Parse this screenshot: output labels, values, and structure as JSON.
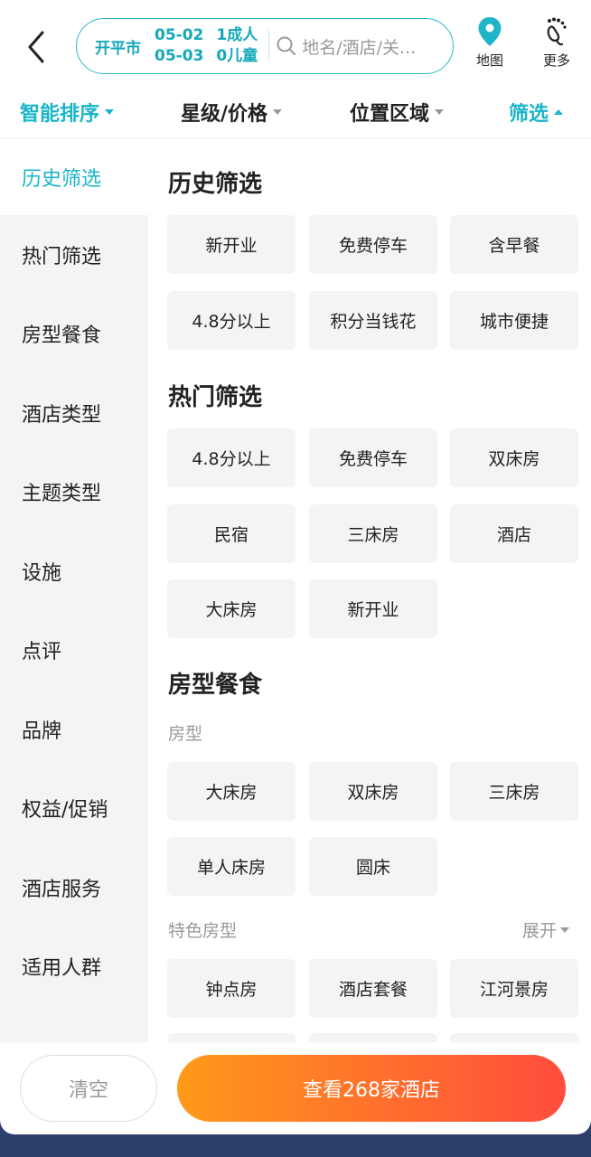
{
  "header": {
    "city": "开平市",
    "checkin_date": "05-02",
    "checkout_date": "05-03",
    "adults": "1成人",
    "children": "0儿童",
    "search_placeholder": "地名/酒店/关...",
    "map_label": "地图",
    "more_label": "更多"
  },
  "tabs": [
    {
      "label": "智能排序"
    },
    {
      "label": "星级/价格"
    },
    {
      "label": "位置区域"
    },
    {
      "label": "筛选"
    }
  ],
  "sidebar": {
    "items": [
      {
        "label": "历史筛选"
      },
      {
        "label": "热门筛选"
      },
      {
        "label": "房型餐食"
      },
      {
        "label": "酒店类型"
      },
      {
        "label": "主题类型"
      },
      {
        "label": "设施"
      },
      {
        "label": "点评"
      },
      {
        "label": "品牌"
      },
      {
        "label": "权益/促销"
      },
      {
        "label": "酒店服务"
      },
      {
        "label": "适用人群"
      }
    ]
  },
  "sections": {
    "history": {
      "title": "历史筛选",
      "chips": [
        "新开业",
        "免费停车",
        "含早餐",
        "4.8分以上",
        "积分当钱花",
        "城市便捷"
      ]
    },
    "hot": {
      "title": "热门筛选",
      "chips": [
        "4.8分以上",
        "免费停车",
        "双床房",
        "民宿",
        "三床房",
        "酒店",
        "大床房",
        "新开业"
      ]
    },
    "room": {
      "title": "房型餐食",
      "room_type_label": "房型",
      "room_type_chips": [
        "大床房",
        "双床房",
        "三床房",
        "单人床房",
        "圆床"
      ],
      "special_label": "特色房型",
      "expand_label": "展开",
      "special_chips": [
        "钟点房",
        "酒店套餐",
        "江河景房"
      ]
    }
  },
  "footer": {
    "clear_label": "清空",
    "view_label": "查看268家酒店"
  },
  "colors": {
    "accent": "#19b5c8",
    "cta_start": "#ff9a1a",
    "cta_end": "#ff4d3d"
  }
}
